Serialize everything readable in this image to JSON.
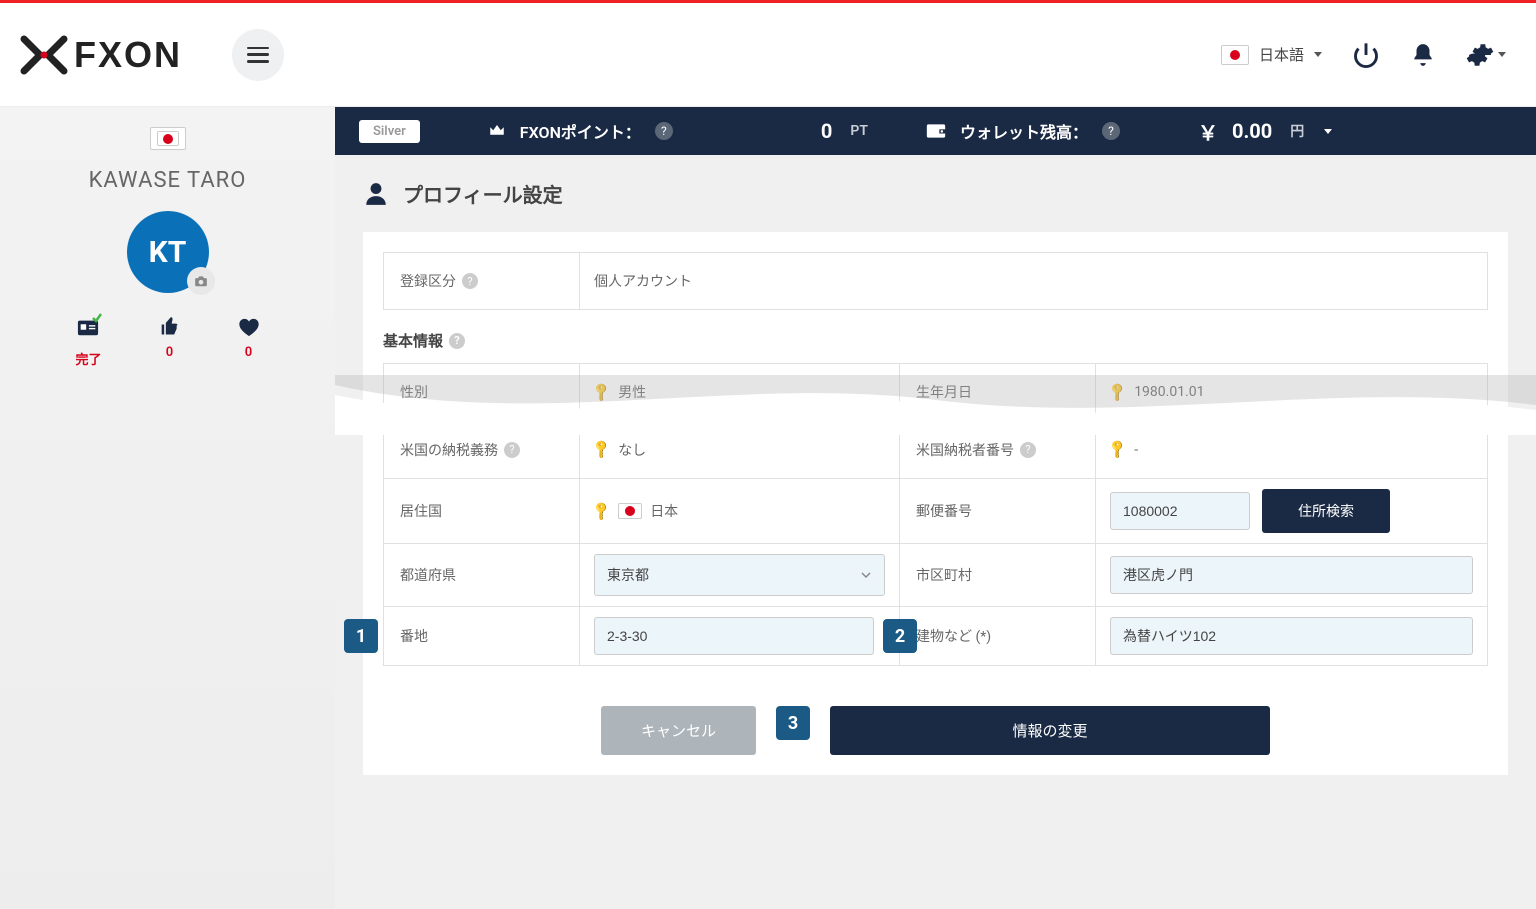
{
  "header": {
    "language": "日本語",
    "logo_text": "FXON"
  },
  "sidebar": {
    "user_name": "KAWASE TARO",
    "avatar_initials": "KT",
    "stats": {
      "id_label": "完了",
      "likes": "0",
      "hearts": "0"
    }
  },
  "status_bar": {
    "tier": "Silver",
    "points_label": "FXONポイント：",
    "points_value": "0",
    "points_unit": "PT",
    "wallet_label": "ウォレット残高：",
    "wallet_currency": "￥",
    "wallet_value": "0.00",
    "wallet_unit": "円"
  },
  "page": {
    "title": "プロフィール設定"
  },
  "form": {
    "reg_type_label": "登録区分",
    "reg_type_value": "個人アカウント",
    "basic_info_label": "基本情報",
    "gender_label": "性別",
    "gender_value": "男性",
    "dob_label": "生年月日",
    "dob_value": "1980.01.01",
    "us_tax_label": "米国の納税義務",
    "us_tax_value": "なし",
    "us_tax_no_label": "米国納税者番号",
    "us_tax_no_value": "-",
    "residence_label": "居住国",
    "residence_value": "日本",
    "postal_label": "郵便番号",
    "postal_value": "1080002",
    "search_addr_btn": "住所検索",
    "prefecture_label": "都道府県",
    "prefecture_value": "東京都",
    "city_label": "市区町村",
    "city_value": "港区虎ノ門",
    "street_label": "番地",
    "street_value": "2-3-30",
    "building_label": "建物など (*)",
    "building_value": "為替ハイツ102"
  },
  "buttons": {
    "cancel": "キャンセル",
    "submit": "情報の変更"
  },
  "badges": {
    "b1": "1",
    "b2": "2",
    "b3": "3"
  }
}
